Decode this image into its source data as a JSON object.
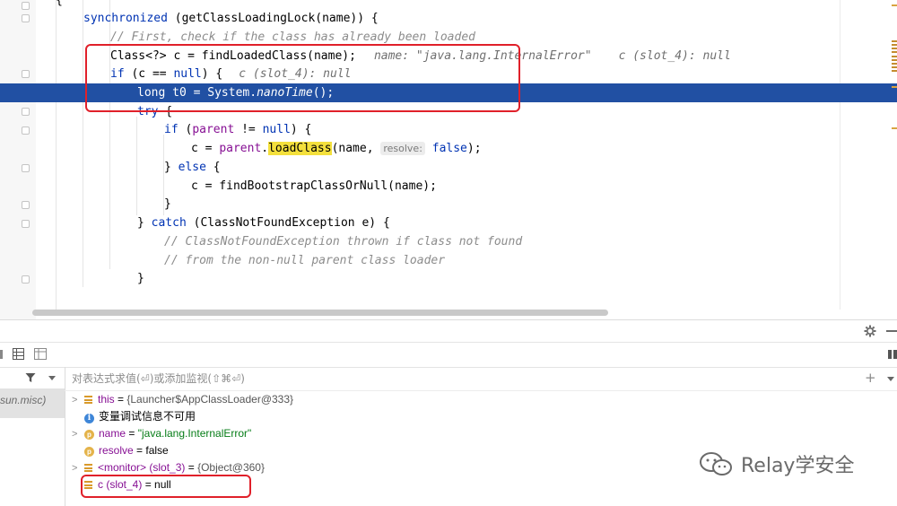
{
  "editor": {
    "lines": {
      "l0": {
        "brace": "{"
      },
      "l1": {
        "kw": "synchronized",
        "rest": " (getClassLoadingLock(name)) {"
      },
      "l2": {
        "comment": "// First, check if the class has already been loaded"
      },
      "l3": {
        "code": "Class<?> c = findLoadedClass(name);",
        "inline1": "name: \"java.lang.InternalError\"",
        "inline2": "c (slot_4): null"
      },
      "l4": {
        "kw": "if",
        "mid": " (c == ",
        "kw2": "null",
        "end": ") {",
        "inline": "c (slot_4): null"
      },
      "l5": {
        "kw": "long",
        "mid": " t0 = System.",
        "method": "nanoTime",
        "end": "();"
      },
      "l6": {
        "kw": "try",
        "end": " {"
      },
      "l7": {
        "kw": "if",
        "mid": " (",
        "field": "parent",
        "mid2": " != ",
        "kw2": "null",
        "end": ") {"
      },
      "l8": {
        "start": "c = ",
        "field": "parent",
        "dot": ".",
        "method": "loadClass",
        "args": "(name, ",
        "hint": "resolve:",
        "kw": "false",
        "end": ");"
      },
      "l9": {
        "start": "} ",
        "kw": "else",
        "end": " {"
      },
      "l10": {
        "code": "c = findBootstrapClassOrNull(name);"
      },
      "l11": {
        "code": "}"
      },
      "l12": {
        "start": "} ",
        "kw": "catch",
        "end": " (ClassNotFoundException e) {"
      },
      "l13": {
        "comment": "// ClassNotFoundException thrown if class not found"
      },
      "l14": {
        "comment": "// from the non-null parent class loader"
      },
      "l15": {
        "code": "}"
      }
    }
  },
  "debugger": {
    "frame_label": "sun.misc)",
    "search": {
      "placeholder": "对表达式求值(⏎)或添加监视(⇧⌘⏎)"
    },
    "variables": [
      {
        "name": "this",
        "eq": " = ",
        "value": "{Launcher$AppClassLoader@333}"
      },
      {
        "text": "变量调试信息不可用"
      },
      {
        "name": "name",
        "eq": " = ",
        "value": "\"java.lang.InternalError\""
      },
      {
        "name": "resolve",
        "eq": " = ",
        "value": "false"
      },
      {
        "name": "<monitor> (slot_3)",
        "eq": " = ",
        "value": "{Object@360}"
      },
      {
        "name": "c (slot_4)",
        "eq": " = ",
        "value": "null"
      }
    ]
  },
  "watermark": {
    "text": "Relay学安全"
  },
  "colors": {
    "highlight": "#2150a3",
    "annotation": "#e0202a",
    "keyword": "#0033b3",
    "usage": "#f4e03c"
  }
}
